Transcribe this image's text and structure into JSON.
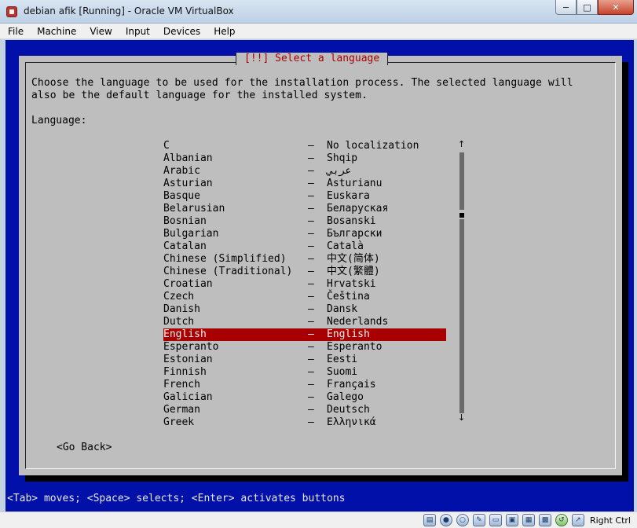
{
  "window": {
    "title": "debian afik [Running] - Oracle VM VirtualBox",
    "controls": {
      "minimize": "−",
      "maximize": "□",
      "close": "✕"
    }
  },
  "menu": [
    "File",
    "Machine",
    "View",
    "Input",
    "Devices",
    "Help"
  ],
  "installer": {
    "title": "[!!] Select a language",
    "description": "Choose the language to be used for the installation process. The selected language will\nalso be the default language for the installed system.",
    "list_label": "Language:",
    "languages": [
      {
        "name": "C",
        "native": "No localization"
      },
      {
        "name": "Albanian",
        "native": "Shqip"
      },
      {
        "name": "Arabic",
        "native": "عربي"
      },
      {
        "name": "Asturian",
        "native": "Asturianu"
      },
      {
        "name": "Basque",
        "native": "Euskara"
      },
      {
        "name": "Belarusian",
        "native": "Беларуская"
      },
      {
        "name": "Bosnian",
        "native": "Bosanski"
      },
      {
        "name": "Bulgarian",
        "native": "Български"
      },
      {
        "name": "Catalan",
        "native": "Català"
      },
      {
        "name": "Chinese (Simplified)",
        "native": "中文(简体)"
      },
      {
        "name": "Chinese (Traditional)",
        "native": "中文(繁體)"
      },
      {
        "name": "Croatian",
        "native": "Hrvatski"
      },
      {
        "name": "Czech",
        "native": "Čeština"
      },
      {
        "name": "Danish",
        "native": "Dansk"
      },
      {
        "name": "Dutch",
        "native": "Nederlands"
      },
      {
        "name": "English",
        "native": "English"
      },
      {
        "name": "Esperanto",
        "native": "Esperanto"
      },
      {
        "name": "Estonian",
        "native": "Eesti"
      },
      {
        "name": "Finnish",
        "native": "Suomi"
      },
      {
        "name": "French",
        "native": "Français"
      },
      {
        "name": "Galician",
        "native": "Galego"
      },
      {
        "name": "German",
        "native": "Deutsch"
      },
      {
        "name": "Greek",
        "native": "Ελληνικά"
      }
    ],
    "separator": "–",
    "selected_language": "English",
    "go_back": "<Go Back>",
    "help_line": "<Tab> moves; <Space> selects; <Enter> activates buttons",
    "scroll_up": "↑",
    "scroll_down": "↓"
  },
  "statusbar": {
    "icons": [
      "hard-disk-icon",
      "optical-disk-icon",
      "floppy-icon",
      "usb-icon",
      "shared-folder-icon",
      "display-icon",
      "network-icon",
      "network-icon-2",
      "recording-icon",
      "mouse-integration-icon"
    ],
    "host_key": "Right Ctrl"
  },
  "colors": {
    "installer_blue": "#0010a8",
    "dialog_gray": "#bebebe",
    "highlight_red": "#a80000"
  }
}
